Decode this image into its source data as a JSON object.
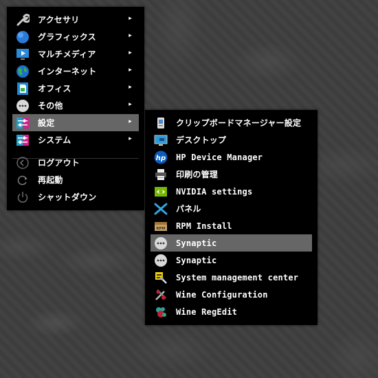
{
  "main_menu": {
    "items": [
      {
        "label": "アクセサリ",
        "icon": "wrench-icon",
        "has_submenu": true
      },
      {
        "label": "グラフィックス",
        "icon": "graphics-globe-icon",
        "has_submenu": true
      },
      {
        "label": "マルチメディア",
        "icon": "monitor-play-icon",
        "has_submenu": true
      },
      {
        "label": "インターネット",
        "icon": "earth-globe-icon",
        "has_submenu": true
      },
      {
        "label": "オフィス",
        "icon": "office-document-icon",
        "has_submenu": true
      },
      {
        "label": "その他",
        "icon": "more-dots-icon",
        "has_submenu": true
      },
      {
        "label": "設定",
        "icon": "settings-sliders-icon",
        "has_submenu": true,
        "selected": true
      },
      {
        "label": "システム",
        "icon": "system-sliders-icon",
        "has_submenu": true
      }
    ],
    "actions": [
      {
        "label": "ログアウト",
        "icon": "logout-icon"
      },
      {
        "label": "再起動",
        "icon": "restart-icon"
      },
      {
        "label": "シャットダウン",
        "icon": "power-icon"
      }
    ],
    "submenu_arrow": "▸"
  },
  "settings_submenu": {
    "items": [
      {
        "label": "クリップボードマネージャー設定",
        "icon": "clipboard-icon"
      },
      {
        "label": "デスクトップ",
        "icon": "desktop-icon"
      },
      {
        "label": "HP Device Manager",
        "icon": "hp-logo-icon"
      },
      {
        "label": "印刷の管理",
        "icon": "printer-icon"
      },
      {
        "label": "NVIDIA settings",
        "icon": "nvidia-icon"
      },
      {
        "label": "パネル",
        "icon": "panel-arrows-icon"
      },
      {
        "label": "RPM Install",
        "icon": "package-box-icon"
      },
      {
        "label": "Synaptic",
        "icon": "more-dots-icon",
        "selected": true
      },
      {
        "label": "Synaptic",
        "icon": "more-dots-icon"
      },
      {
        "label": "System management center",
        "icon": "system-management-icon"
      },
      {
        "label": "Wine Configuration",
        "icon": "wine-config-icon"
      },
      {
        "label": "Wine RegEdit",
        "icon": "wine-regedit-icon"
      }
    ],
    "hp_logo_text": "hp",
    "rpm_box_text": "RPM"
  },
  "colors": {
    "menu_bg": "#000000",
    "selected_bg": "#666666",
    "text": "#ffffff"
  }
}
